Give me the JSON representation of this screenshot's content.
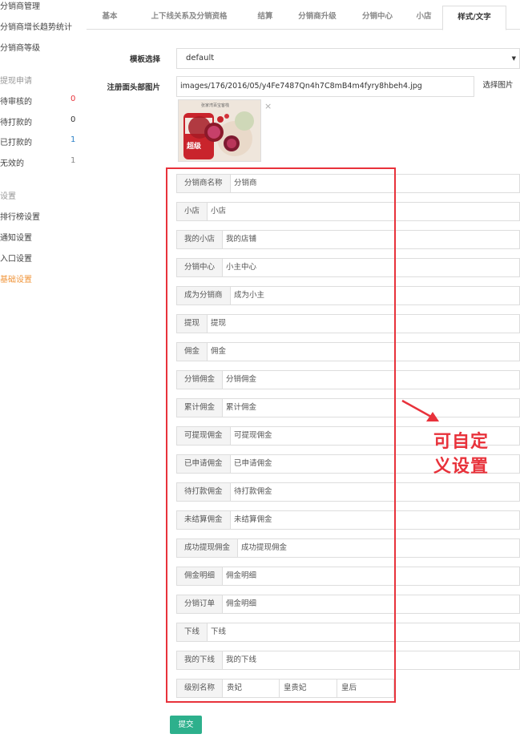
{
  "sidebar": {
    "items": [
      {
        "label": "分销商管理"
      },
      {
        "label": "分销商增长趋势统计"
      },
      {
        "label": "分销商等级"
      }
    ],
    "withdraw_group": "提现申请",
    "withdraw_items": [
      {
        "label": "待审核的",
        "count": "0",
        "color": "#e8323b"
      },
      {
        "label": "待打款的",
        "count": "0",
        "color": "#333333"
      },
      {
        "label": "已打款的",
        "count": "1",
        "color": "#2a7fc6"
      },
      {
        "label": "无效的",
        "count": "1",
        "color": "#888888"
      }
    ],
    "settings_group": "设置",
    "settings_items": [
      {
        "label": "排行榜设置"
      },
      {
        "label": "通知设置"
      },
      {
        "label": "入口设置"
      },
      {
        "label": "基础设置",
        "active": true
      }
    ]
  },
  "tabs": [
    "基本",
    "上下线关系及分销资格",
    "结算",
    "分销商升级",
    "分销中心",
    "小店",
    "样式/文字"
  ],
  "form": {
    "template_label": "模板选择",
    "template_value": "default",
    "header_image_label": "注册面头部图片",
    "header_image_path": "images/176/2016/05/y4Fe7487Qn4h7C8mB4m4fyry8hbeh4.jpg",
    "choose_image_button": "选择图片",
    "thumb_caption": "张家湾百宝客栈",
    "thumb_tag": "超级",
    "close_glyph": "×",
    "fields": [
      {
        "label": "分销商名称",
        "value": "分销商"
      },
      {
        "label": "小店",
        "value": "小店"
      },
      {
        "label": "我的小店",
        "value": "我的店铺"
      },
      {
        "label": "分销中心",
        "value": "小主中心"
      },
      {
        "label": "成为分销商",
        "value": "成为小主"
      },
      {
        "label": "提现",
        "value": "提现"
      },
      {
        "label": "佣金",
        "value": "佣金"
      },
      {
        "label": "分销佣金",
        "value": "分销佣金"
      },
      {
        "label": "累计佣金",
        "value": "累计佣金"
      },
      {
        "label": "可提现佣金",
        "value": "可提现佣金"
      },
      {
        "label": "已申请佣金",
        "value": "已申请佣金"
      },
      {
        "label": "待打款佣金",
        "value": "待打款佣金"
      },
      {
        "label": "未结算佣金",
        "value": "未结算佣金"
      },
      {
        "label": "成功提现佣金",
        "value": "成功提现佣金"
      },
      {
        "label": "佣金明细",
        "value": "佣金明细"
      },
      {
        "label": "分销订单",
        "value": "佣金明细"
      },
      {
        "label": "下线",
        "value": "下线"
      },
      {
        "label": "我的下线",
        "value": "我的下线"
      }
    ],
    "level_label": "级别名称",
    "levels": [
      "贵妃",
      "皇贵妃",
      "皇后"
    ],
    "submit_label": "提交"
  },
  "annotation": {
    "line1": "可自定",
    "line2": "义设置",
    "color": "#e8323b"
  }
}
